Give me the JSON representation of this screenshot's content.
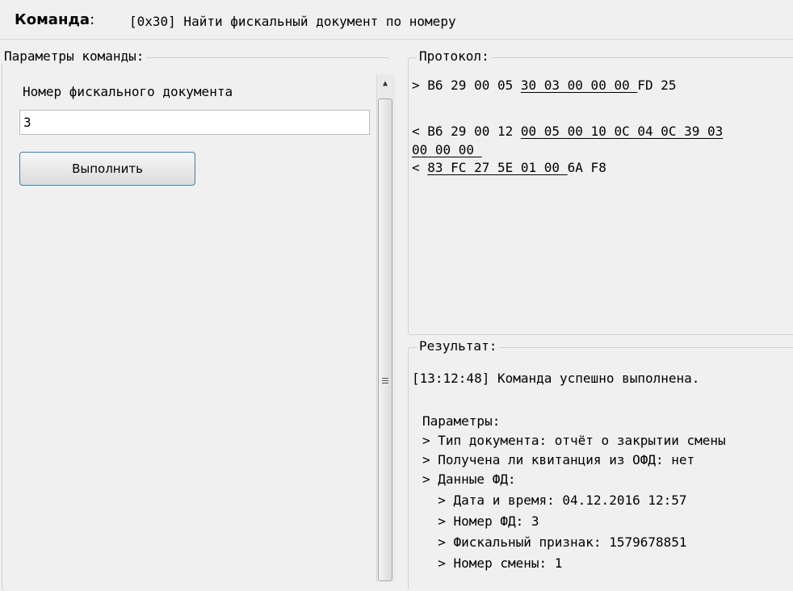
{
  "header": {
    "title_label": "Команда",
    "title_colon": ":",
    "command": "[0x30] Найти фискальный документ по номеру"
  },
  "params": {
    "group_title": "Параметры команды:",
    "field_label": "Номер фискального документа",
    "field_value": "3",
    "run_button": "Выполнить"
  },
  "protocol": {
    "group_title": "Протокол:",
    "line1": {
      "prefix": "> B6 29 00 05 ",
      "data": "30 03 00 00 00 ",
      "suffix": "FD 25"
    },
    "line2": {
      "prefix": "< B6 29 00 12 ",
      "data": "00 05 00 10 0C 04 0C 39 03"
    },
    "line3": {
      "data": "00 00 00 "
    },
    "line4": {
      "prefix": "< ",
      "data": "83 FC 27 5E 01 00 ",
      "suffix": "6A F8"
    }
  },
  "result": {
    "group_title": "Результат:",
    "status": "[13:12:48] Команда успешно выполнена.",
    "params_header": "Параметры:",
    "lines": [
      "> Тип документа: отчёт о закрытии смены",
      "> Получена ли квитанция из ОФД: нет",
      "> Данные ФД:",
      "  > Дата и время: 04.12.2016 12:57",
      "  > Номер ФД: 3",
      "  > Фискальный признак: 1579678851",
      "  > Номер смены: 1"
    ]
  }
}
